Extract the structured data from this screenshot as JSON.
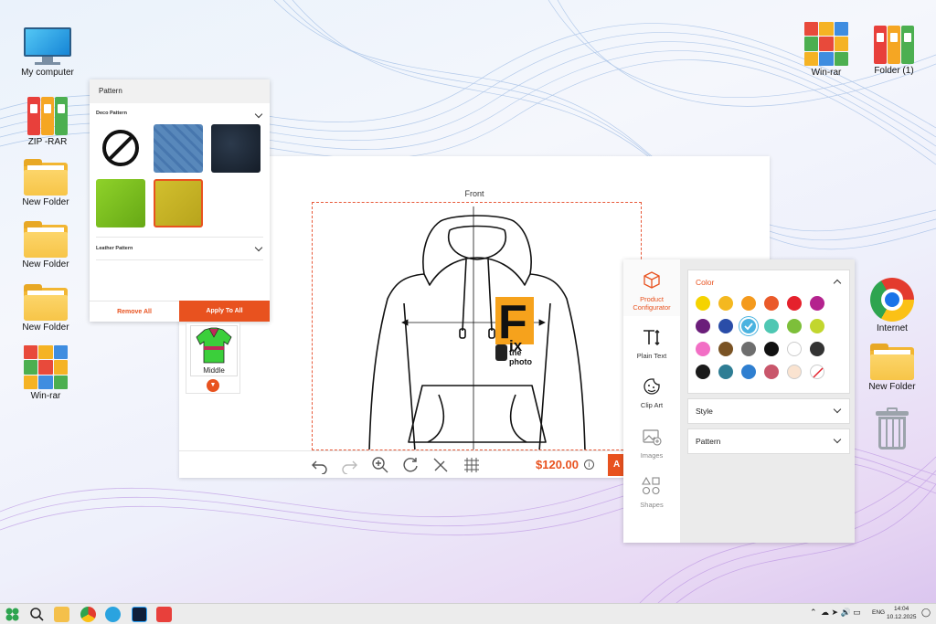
{
  "desktop": {
    "left_icons": [
      {
        "label": "My computer"
      },
      {
        "label": "ZIP -RAR"
      },
      {
        "label": "New Folder"
      },
      {
        "label": "New Folder"
      },
      {
        "label": "New Folder"
      },
      {
        "label": "Win-rar"
      }
    ],
    "right_icons": [
      {
        "label": "Win-rar"
      },
      {
        "label": "Folder (1)"
      },
      {
        "label": "Internet"
      },
      {
        "label": "New Folder"
      }
    ]
  },
  "pattern_panel": {
    "title": "Pattern",
    "deco_section": "Deco Pattern",
    "leather_section": "Leather Pattern",
    "swatches": [
      "none",
      "#8fb4d6",
      "#1f2a38",
      "#7cc21e",
      "#c6b326"
    ],
    "selected_index": 4,
    "remove_label": "Remove All",
    "apply_label": "Apply To All"
  },
  "designer": {
    "view_label": "Front",
    "price": "$120.00",
    "info_icon": "i",
    "add_button": "A",
    "logo_letter": "F",
    "logo_ix": "ix",
    "logo_the": "the",
    "logo_photo": "photo",
    "toolbar_icons": [
      "undo-icon",
      "redo-icon",
      "zoom-in-icon",
      "reset-icon",
      "no-tools-icon",
      "grid-icon"
    ]
  },
  "thumbnail": {
    "label": "Middle"
  },
  "configurator": {
    "tabs": [
      {
        "label": "Product Configurator",
        "icon": "cube-icon",
        "active": true
      },
      {
        "label": "Plain Text",
        "icon": "text-icon"
      },
      {
        "label": "Clip Art",
        "icon": "clipart-icon"
      },
      {
        "label": "Images",
        "icon": "image-icon"
      },
      {
        "label": "Shapes",
        "icon": "shapes-icon"
      }
    ],
    "color_title": "Color",
    "style_title": "Style",
    "pattern_title": "Pattern",
    "colors": [
      "#f5d300",
      "#f4b820",
      "#f49a1d",
      "#ea5a2a",
      "#e5212c",
      "#b4238e",
      "#6b1e7a",
      "#2a4da8",
      "#4ab3e0",
      "#4fc7b3",
      "#7dbf3a",
      "#c2d62e",
      "#f26fc5",
      "#7a5324",
      "#6e6e6e",
      "#111111",
      "#ffffff",
      "#333333",
      "#1a1a1a",
      "#2e7d94",
      "#2f7fd0",
      "#c9566b",
      "#fae3d0",
      "none"
    ],
    "selected_color_index": 8
  },
  "taskbar": {
    "lang": "ENG",
    "time": "14:04",
    "date": "10.12.2025"
  }
}
